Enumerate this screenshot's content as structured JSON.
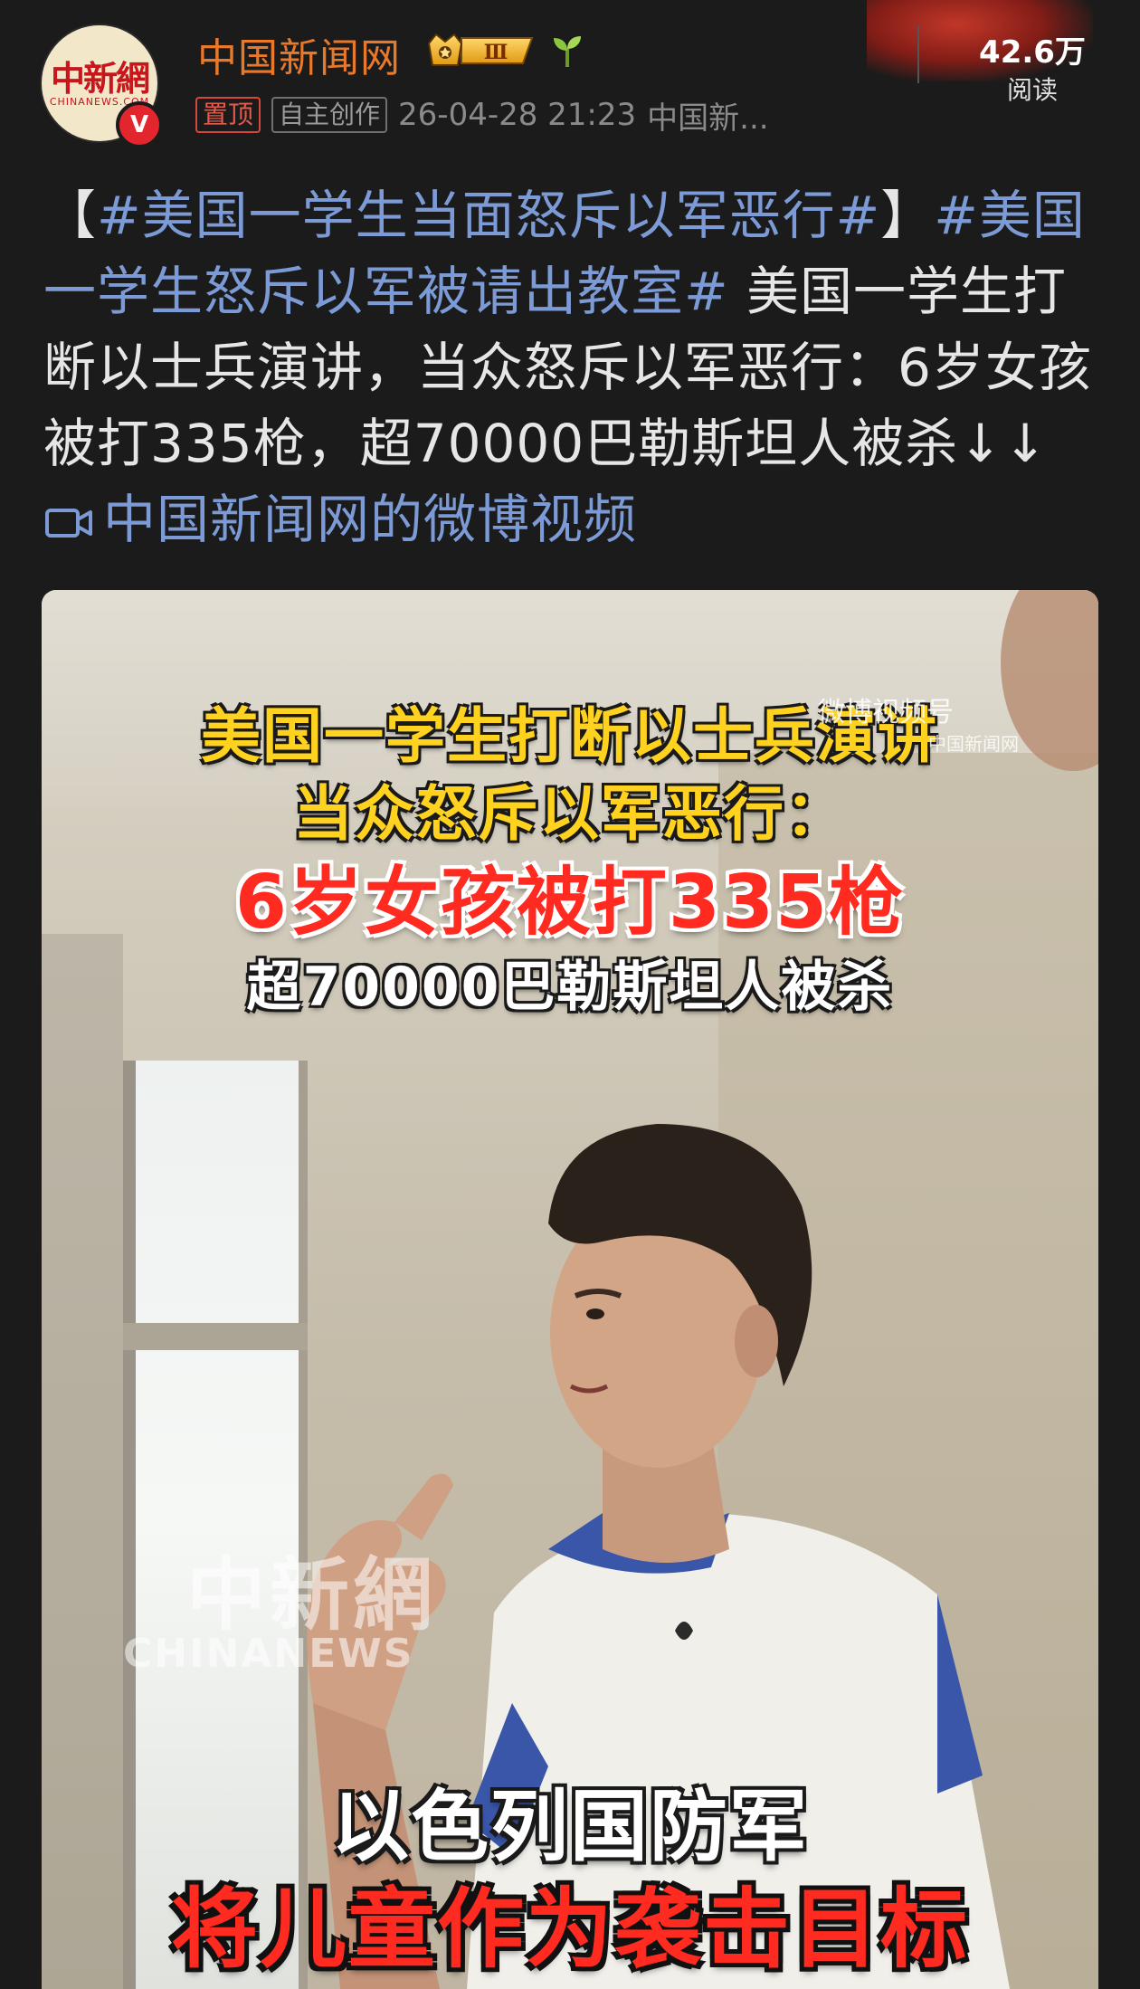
{
  "header": {
    "avatar_text_cn": "中新網",
    "avatar_text_en": "CHINANEWS.COM",
    "verified_mark": "V",
    "username": "中国新闻网",
    "level_badge": "Ⅲ",
    "tags": {
      "pinned": "置顶",
      "original": "自主创作"
    },
    "timestamp": "26-04-28 21:23",
    "source": "中国新...",
    "reads_count": "42.6万",
    "reads_label": "阅读"
  },
  "post": {
    "bracket_open": "【",
    "hashtag_1": "#美国一学生当面怒斥以军恶行#",
    "bracket_close": "】",
    "hashtag_2": "#美国一学生怒斥以军被请出教室#",
    "body": " 美国一学生打断以士兵演讲，当众怒斥以军恶行：6岁女孩被打335枪，超70000巴勒斯坦人被杀↓↓ ",
    "video_link": "中国新闻网的微博视频"
  },
  "video": {
    "headline_1": "美国一学生打断以士兵演讲",
    "headline_2": "当众怒斥以军恶行：",
    "headline_3": "6岁女孩被打335枪",
    "headline_4": "超70000巴勒斯坦人被杀",
    "watermark_weibo": "微博视频号",
    "watermark_weibo_sub": "中国新闻网",
    "watermark_cn": "中新網",
    "watermark_en": "CHINANEWS",
    "subtitle_1": "以色列国防军",
    "subtitle_2": "将儿童作为袭击目标"
  },
  "colors": {
    "background": "#1b1b1b",
    "username": "#e8782a",
    "hashtag": "#7c9bd6",
    "headline_yellow": "#ffd21f",
    "headline_red": "#ff2a20"
  }
}
